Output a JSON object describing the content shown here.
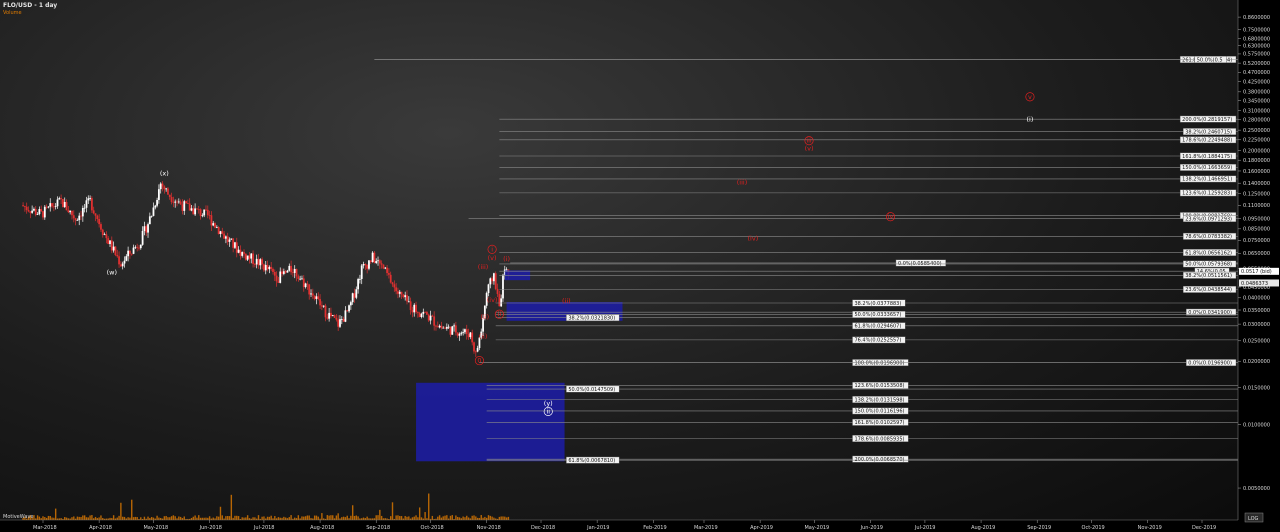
{
  "chart": {
    "title": "FLO/USD - 1 day",
    "volume_label": "Volume",
    "indicator_label": "MotiveWave",
    "corner_button": "LOG",
    "colors": {
      "up": "#ffffff",
      "down": "#e03030",
      "grid": "#8a8a8a",
      "zone": "#1c1ca8",
      "wave_white": "#ffffff",
      "wave_red": "#e02020",
      "volume": "#e07b00"
    }
  },
  "chart_data": {
    "type": "candlestick",
    "title": "FLO/USD - 1 day",
    "y_scale": "log",
    "ylim": [
      0.0042,
      0.95
    ],
    "x_ticks": [
      {
        "date": "2018-03-01",
        "label": "Mar-2018"
      },
      {
        "date": "2018-04-01",
        "label": "Apr-2018"
      },
      {
        "date": "2018-05-01",
        "label": "May-2018"
      },
      {
        "date": "2018-06-01",
        "label": "Jun-2018"
      },
      {
        "date": "2018-07-01",
        "label": "Jul-2018"
      },
      {
        "date": "2018-08-01",
        "label": "Aug-2018"
      },
      {
        "date": "2018-09-01",
        "label": "Sep-2018"
      },
      {
        "date": "2018-10-01",
        "label": "Oct-2018"
      },
      {
        "date": "2018-11-01",
        "label": "Nov-2018"
      },
      {
        "date": "2018-12-01",
        "label": "Dec-2018"
      },
      {
        "date": "2019-01-01",
        "label": "Jan-2019"
      },
      {
        "date": "2019-02-01",
        "label": "Feb-2019"
      },
      {
        "date": "2019-03-01",
        "label": "Mar-2019"
      },
      {
        "date": "2019-04-01",
        "label": "Apr-2019"
      },
      {
        "date": "2019-05-01",
        "label": "May-2019"
      },
      {
        "date": "2019-06-01",
        "label": "Jun-2019"
      },
      {
        "date": "2019-07-01",
        "label": "Jul-2019"
      },
      {
        "date": "2019-08-01",
        "label": "Aug-2019"
      },
      {
        "date": "2019-09-01",
        "label": "Sep-2019"
      },
      {
        "date": "2019-10-01",
        "label": "Oct-2019"
      },
      {
        "date": "2019-11-01",
        "label": "Nov-2019"
      },
      {
        "date": "2019-12-01",
        "label": "Dec-2019"
      }
    ],
    "y_ticks": [
      {
        "value": 0.86,
        "label": "0.8600000"
      },
      {
        "value": 0.75,
        "label": "0.7500000"
      },
      {
        "value": 0.68,
        "label": "0.6800000"
      },
      {
        "value": 0.63,
        "label": "0.6300000"
      },
      {
        "value": 0.575,
        "label": "0.5750000"
      },
      {
        "value": 0.52,
        "label": "0.5200000"
      },
      {
        "value": 0.47,
        "label": "0.4700000"
      },
      {
        "value": 0.425,
        "label": "0.4250000"
      },
      {
        "value": 0.38,
        "label": "0.3800000"
      },
      {
        "value": 0.345,
        "label": "0.3450000"
      },
      {
        "value": 0.31,
        "label": "0.3100000"
      },
      {
        "value": 0.28,
        "label": "0.2800000"
      },
      {
        "value": 0.25,
        "label": "0.2500000"
      },
      {
        "value": 0.225,
        "label": "0.2250000"
      },
      {
        "value": 0.2,
        "label": "0.2000000"
      },
      {
        "value": 0.18,
        "label": "0.1800000"
      },
      {
        "value": 0.16,
        "label": "0.1600000"
      },
      {
        "value": 0.14,
        "label": "0.1400000"
      },
      {
        "value": 0.125,
        "label": "0.1250000"
      },
      {
        "value": 0.11,
        "label": "0.1100000"
      },
      {
        "value": 0.095,
        "label": "0.0950000"
      },
      {
        "value": 0.085,
        "label": "0.0850000"
      },
      {
        "value": 0.075,
        "label": "0.0750000"
      },
      {
        "value": 0.065,
        "label": "0.0650000"
      },
      {
        "value": 0.055,
        "label": "0.0550000"
      },
      {
        "value": 0.045,
        "label": "0.0450000"
      },
      {
        "value": 0.04,
        "label": "0.0400000"
      },
      {
        "value": 0.035,
        "label": "0.0350000"
      },
      {
        "value": 0.03,
        "label": "0.0300000"
      },
      {
        "value": 0.025,
        "label": "0.0250000"
      },
      {
        "value": 0.02,
        "label": "0.0200000"
      },
      {
        "value": 0.015,
        "label": "0.0150000"
      },
      {
        "value": 0.01,
        "label": "0.0100000"
      },
      {
        "value": 0.005,
        "label": "0.0050000"
      }
    ],
    "last_price_tags": [
      {
        "value": 0.0517,
        "label": "0.0517 (bid)"
      },
      {
        "value": 0.0486,
        "label": "0.0486373"
      }
    ],
    "price_path": [
      {
        "date": "2018-02-18",
        "price": 0.11
      },
      {
        "date": "2018-03-01",
        "price": 0.1
      },
      {
        "date": "2018-03-12",
        "price": 0.115
      },
      {
        "date": "2018-03-20",
        "price": 0.095
      },
      {
        "date": "2018-03-28",
        "price": 0.115
      },
      {
        "date": "2018-04-05",
        "price": 0.08
      },
      {
        "date": "2018-04-14",
        "price": 0.058
      },
      {
        "date": "2018-04-25",
        "price": 0.075
      },
      {
        "date": "2018-05-01",
        "price": 0.1
      },
      {
        "date": "2018-05-06",
        "price": 0.14
      },
      {
        "date": "2018-05-10",
        "price": 0.125
      },
      {
        "date": "2018-05-18",
        "price": 0.11
      },
      {
        "date": "2018-06-01",
        "price": 0.098
      },
      {
        "date": "2018-06-12",
        "price": 0.075
      },
      {
        "date": "2018-06-20",
        "price": 0.065
      },
      {
        "date": "2018-06-30",
        "price": 0.058
      },
      {
        "date": "2018-07-10",
        "price": 0.05
      },
      {
        "date": "2018-07-18",
        "price": 0.055
      },
      {
        "date": "2018-07-26",
        "price": 0.045
      },
      {
        "date": "2018-08-04",
        "price": 0.035
      },
      {
        "date": "2018-08-12",
        "price": 0.03
      },
      {
        "date": "2018-08-18",
        "price": 0.035
      },
      {
        "date": "2018-08-25",
        "price": 0.055
      },
      {
        "date": "2018-08-31",
        "price": 0.062
      },
      {
        "date": "2018-09-06",
        "price": 0.055
      },
      {
        "date": "2018-09-14",
        "price": 0.042
      },
      {
        "date": "2018-09-22",
        "price": 0.036
      },
      {
        "date": "2018-09-30",
        "price": 0.033
      },
      {
        "date": "2018-10-08",
        "price": 0.029
      },
      {
        "date": "2018-10-16",
        "price": 0.028
      },
      {
        "date": "2018-10-24",
        "price": 0.027
      },
      {
        "date": "2018-10-27",
        "price": 0.0215
      },
      {
        "date": "2018-10-30",
        "price": 0.028
      },
      {
        "date": "2018-11-02",
        "price": 0.042
      },
      {
        "date": "2018-11-06",
        "price": 0.052
      },
      {
        "date": "2018-11-09",
        "price": 0.036
      },
      {
        "date": "2018-11-12",
        "price": 0.057
      },
      {
        "date": "2018-11-14",
        "price": 0.0486
      }
    ],
    "fib_zones": [
      {
        "x0": "2018-11-11",
        "x1": "2018-11-25",
        "y0": 0.0485,
        "y1": 0.054
      },
      {
        "x0": "2018-11-12",
        "x1": "2019-01-15",
        "y0": 0.0311,
        "y1": 0.0382
      },
      {
        "x0": "2018-09-23",
        "x1": "2018-12-14",
        "y0": 0.0067,
        "y1": 0.0158
      }
    ],
    "fib_levels": [
      {
        "value": 0.5410424,
        "label": "261.8%(0.5410424)",
        "x0": "2018-08-31",
        "x1": "2019-12-31",
        "lx": "2019-12-08"
      },
      {
        "value": 0.5410424,
        "label": "50.0%(0.5",
        "x0": "2018-08-31",
        "x1": "2019-12-31",
        "lx": "2019-11-27"
      },
      {
        "value": 0.2819157,
        "label": "200.0%(0.2819157)",
        "x0": "2018-11-08",
        "x1": "2019-12-31",
        "lx": "2019-12-01"
      },
      {
        "value": 0.2460715,
        "label": "38.2%(0.2460715)",
        "x0": "2018-11-08",
        "x1": "2019-12-31",
        "lx": "2019-11-27"
      },
      {
        "value": 0.2249488,
        "label": "178.6%(0.2249488)",
        "x0": "2018-11-08",
        "x1": "2019-12-31",
        "lx": "2019-12-01"
      },
      {
        "value": 0.1884175,
        "label": "161.8%(0.1884175)",
        "x0": "2018-11-08",
        "x1": "2019-12-31",
        "lx": "2019-11-29"
      },
      {
        "value": 0.1663659,
        "label": "150.0%(0.1663659)",
        "x0": "2018-11-08",
        "x1": "2019-12-31",
        "lx": "2019-11-29"
      },
      {
        "value": 0.1466951,
        "label": "138.2%(0.1466951)",
        "x0": "2018-11-08",
        "x1": "2019-12-31",
        "lx": "2019-11-29"
      },
      {
        "value": 0.1259283,
        "label": "123.6%(0.1259283)",
        "x0": "2018-11-08",
        "x1": "2019-12-31",
        "lx": "2019-11-29"
      },
      {
        "value": 0.0981769,
        "label": "100.0%(0.0981769)",
        "x0": "2018-11-08",
        "x1": "2019-12-31",
        "lx": "2019-11-29"
      },
      {
        "value": 0.0951,
        "label": "23.6%(0.0971293)",
        "x0": "2018-10-22",
        "x1": "2019-12-31",
        "lx": "2019-11-27"
      },
      {
        "value": 0.0783382,
        "label": "78.6%(0.0783382)",
        "x0": "2018-11-08",
        "x1": "2019-12-31",
        "lx": "2019-11-29"
      },
      {
        "value": 0.0656162,
        "label": "61.8%(0.0656162)",
        "x0": "2018-11-08",
        "x1": "2019-12-31",
        "lx": "2019-11-29"
      },
      {
        "value": 0.05854,
        "label": "0.0%(0.0585400)",
        "x0": "2018-11-14",
        "x1": "2019-12-31",
        "lx": "2019-06-15"
      },
      {
        "value": 0.0579368,
        "label": "50.0%(0.0579368)",
        "x0": "2018-11-08",
        "x1": "2019-12-31",
        "lx": "2019-11-29"
      },
      {
        "value": 0.0535,
        "label": "14.6%(0.05",
        "x0": "2018-11-08",
        "x1": "2019-12-31",
        "lx": "2019-11-27"
      },
      {
        "value": 0.0511561,
        "label": "38.2%(0.0511561)",
        "x0": "2018-11-08",
        "x1": "2019-12-31",
        "lx": "2019-12-03"
      },
      {
        "value": 0.0438544,
        "label": "23.6%(0.0438544)",
        "x0": "2018-11-08",
        "x1": "2019-12-31",
        "lx": "2019-11-29"
      },
      {
        "value": 0.0377883,
        "label": "38.2%(0.0377883)",
        "x0": "2018-11-06",
        "x1": "2019-12-31",
        "lx": "2019-05-22"
      },
      {
        "value": 0.03419,
        "label": "0.0%(0.0341900)",
        "x0": "2018-11-06",
        "x1": "2019-12-31",
        "lx": "2019-11-28"
      },
      {
        "value": 0.0333657,
        "label": "50.0%(0.0333657)",
        "x0": "2018-11-06",
        "x1": "2019-12-31",
        "lx": "2019-05-22"
      },
      {
        "value": 0.032183,
        "label": "38.2%(0.0321830)",
        "x0": "2018-11-06",
        "x1": "2019-12-31",
        "lx": "2018-12-15"
      },
      {
        "value": 0.0294607,
        "label": "61.8%(0.0294607)",
        "x0": "2018-11-06",
        "x1": "2019-12-31",
        "lx": "2019-05-22"
      },
      {
        "value": 0.0252557,
        "label": "76.4%(0.0252557)",
        "x0": "2018-11-06",
        "x1": "2019-12-31",
        "lx": "2019-05-22"
      },
      {
        "value": 0.01969,
        "label": "100.0%(0.0196900)",
        "x0": "2018-10-28",
        "x1": "2019-12-31",
        "lx": "2019-05-22"
      },
      {
        "value": 0.01969,
        "label": "0.0%(0.0196900)",
        "x0": "2018-10-28",
        "x1": "2019-12-31",
        "lx": "2019-11-23"
      },
      {
        "value": 0.0153508,
        "label": "123.6%(0.0153508)",
        "x0": "2018-11-01",
        "x1": "2019-12-31",
        "lx": "2019-05-22"
      },
      {
        "value": 0.0147509,
        "label": "50.0%(0.0147509)",
        "x0": "2018-11-01",
        "x1": "2019-12-31",
        "lx": "2018-12-15"
      },
      {
        "value": 0.0131598,
        "label": "138.2%(0.0131598)",
        "x0": "2018-11-01",
        "x1": "2019-12-31",
        "lx": "2019-05-22"
      },
      {
        "value": 0.0116196,
        "label": "150.0%(0.0116196)",
        "x0": "2018-11-01",
        "x1": "2019-12-31",
        "lx": "2019-05-22"
      },
      {
        "value": 0.0102597,
        "label": "161.8%(0.0102597)",
        "x0": "2018-11-01",
        "x1": "2019-12-31",
        "lx": "2019-05-22"
      },
      {
        "value": 0.0085935,
        "label": "178.6%(0.0085935)",
        "x0": "2018-11-01",
        "x1": "2019-12-31",
        "lx": "2019-05-22"
      },
      {
        "value": 0.006857,
        "label": "200.0%(0.0068570)",
        "x0": "2018-11-01",
        "x1": "2019-12-31",
        "lx": "2019-05-22"
      },
      {
        "value": 0.006781,
        "label": "61.8%(0.0067810)",
        "x0": "2018-11-01",
        "x1": "2019-12-31",
        "lx": "2018-12-15"
      }
    ],
    "wave_labels": [
      {
        "text": "(x)",
        "date": "2018-05-07",
        "price": 0.152,
        "color": "white"
      },
      {
        "text": "(w)",
        "date": "2018-04-08",
        "price": 0.0515,
        "color": "white"
      },
      {
        "text": "(y)",
        "date": "2018-12-05",
        "price": 0.0123,
        "color": "white"
      },
      {
        "text": "ii",
        "date": "2018-12-05",
        "price": 0.0113,
        "color": "white",
        "circled": true
      },
      {
        "text": "(i)",
        "date": "2019-08-28",
        "price": 0.275,
        "color": "white"
      },
      {
        "text": "i",
        "date": "2018-11-04",
        "price": 0.0665,
        "color": "red",
        "circled": true
      },
      {
        "text": "(v)",
        "date": "2018-11-04",
        "price": 0.0605,
        "color": "red"
      },
      {
        "text": "(iii)",
        "date": "2018-10-30",
        "price": 0.0548,
        "color": "red"
      },
      {
        "text": "(i)",
        "date": "2018-11-12",
        "price": 0.0598,
        "color": "red"
      },
      {
        "text": "(iv)",
        "date": "2018-11-04",
        "price": 0.0383,
        "color": "red"
      },
      {
        "text": "(ii)",
        "date": "2018-10-31",
        "price": 0.0318,
        "color": "red"
      },
      {
        "text": "(ii)",
        "date": "2018-10-30",
        "price": 0.0256,
        "color": "red"
      },
      {
        "text": "ii",
        "date": "2018-11-08",
        "price": 0.0327,
        "color": "red",
        "circled": true
      },
      {
        "text": "(ii)",
        "date": "2018-12-15",
        "price": 0.0378,
        "color": "red"
      },
      {
        "text": "(iii)",
        "date": "2019-03-22",
        "price": 0.138,
        "color": "red"
      },
      {
        "text": "(iv)",
        "date": "2019-03-28",
        "price": 0.075,
        "color": "red"
      },
      {
        "text": "iii",
        "date": "2019-04-28",
        "price": 0.218,
        "color": "red",
        "circled": true
      },
      {
        "text": "(v)",
        "date": "2019-04-28",
        "price": 0.2,
        "color": "red"
      },
      {
        "text": "iv",
        "date": "2019-06-12",
        "price": 0.095,
        "color": "red",
        "circled": true
      },
      {
        "text": "v",
        "date": "2019-08-28",
        "price": 0.352,
        "color": "red",
        "circled": true
      },
      {
        "text": "0",
        "date": "2018-10-28",
        "price": 0.0197,
        "color": "red",
        "circled": true
      }
    ]
  }
}
